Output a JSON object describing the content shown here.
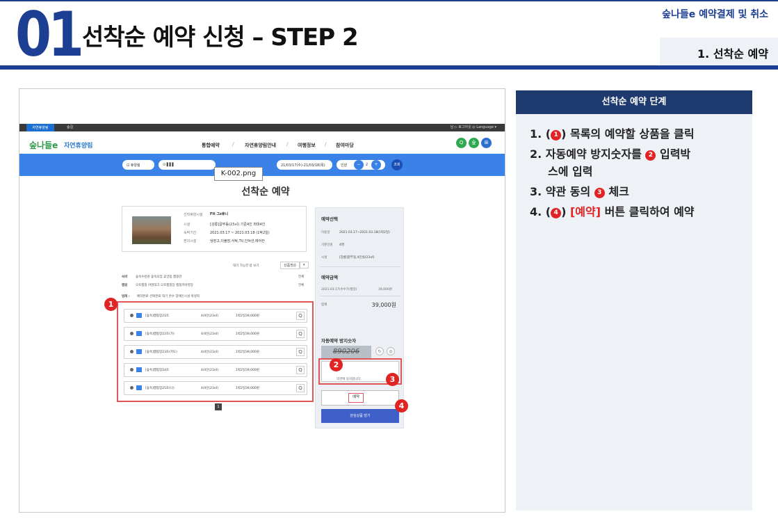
{
  "header": {
    "number": "01",
    "title": "선착순 예약 신청 – STEP 2",
    "subtitle": "숲나들e 예약결제 및 취소",
    "section": "1. 선착순 예약"
  },
  "screenshot": {
    "topbar": {
      "tab1": "자연휴양림",
      "tab2": "숲길",
      "right": "님 ▷ 로그아웃   ◎ Language ▾"
    },
    "logo": "숲나들e",
    "site_name": "자연휴양림",
    "menu": [
      "통합예약",
      "자연휴양림안내",
      "여행정보",
      "참여마당"
    ],
    "menu_sep": "/",
    "nav_icons": [
      "Q",
      "숲",
      "⊞"
    ],
    "search": {
      "field1": "⊡ 휴양림",
      "field2": "⊙ ▌▌▌",
      "dates": "21/03/17(수)-21/03/18(목)",
      "people_label": "인원",
      "people_count": "2",
      "minus": "−",
      "plus": "+",
      "button": "조회"
    },
    "tooltip": "K-002.png",
    "page_title": "선착순 예약",
    "product": {
      "labels": [
        "선착휴양시설",
        "시설",
        "숙박기간",
        "편의시설"
      ],
      "values": [
        "FIt 그z휴니",
        "[강릉]갈뚜동(23㎡) 기준4인 최대4인",
        "2021.03.17 ~ 2021.03.18 (1박2일)",
        "냉장고,이불장,식탁,TV,인덕션,에어컨"
      ]
    },
    "filters": {
      "show_available": "대기 가능한 방 보기",
      "sort": "상품명순",
      "sort_arrow": "▾",
      "row1_label": "숙박",
      "row1": "숲속수련원  숲속의집  휴양림  캠핑관",
      "row1_all": "전체",
      "row2_label": "캠핑",
      "row2": "오토캠핑  야영데크  오토캠핑장  캠핑카야영장",
      "row2_all": "전체",
      "legend_label": "범례 :",
      "legend": "예약완료  선택완료  대기  온수  장애인시설  위생적"
    },
    "rooms": [
      {
        "name": "[숲속]캠핑장21호",
        "size": "4/4인(23㎡)",
        "price": "1박2일39,000원"
      },
      {
        "name": "[숲속]캠핑장22호(가)",
        "size": "4/4인(23㎡)",
        "price": "1박2일39,000원"
      },
      {
        "name": "[숲속]캠핑장23호(지도)",
        "size": "4/4인(23㎡)",
        "price": "1박2일39,000원"
      },
      {
        "name": "[숲속]캠핑장24호",
        "size": "4/4인(23㎡)",
        "price": "1박2일39,000원"
      },
      {
        "name": "[숲속]캠핑장25호(나)",
        "size": "4/4인(23㎡)",
        "price": "1박2일39,000원"
      }
    ],
    "room_magnify": "Q",
    "pagination": "1",
    "side_panel": {
      "select_title": "예약선택",
      "period_label": "이용일",
      "period": "2021.03.17~2021.03.18(1박2일)",
      "people_label": "기준인원",
      "people": "4명",
      "facility_label": "시설",
      "facility": "[강릉]갈뚜동,4인실(23㎡)",
      "amount_title": "예약금액",
      "amount_line_label": "2021.03.17(수수가/평일)",
      "amount_line": "39,000원",
      "total_label": "합계",
      "total": "39,000원",
      "captcha_title": "자동예약 방지숫자",
      "captcha": "890206",
      "refresh": "↻",
      "audio": "◎",
      "agree": "약관에 동의합니다.",
      "reserve": "예약",
      "wishlist": "관심상품 담기"
    },
    "badges": [
      "1",
      "2",
      "3",
      "4"
    ]
  },
  "right_panel": {
    "title": "선착순 예약 단계",
    "steps": [
      {
        "prefix": "1. (",
        "num": "1",
        "suffix": ") 목록의 예약할 상품을 클릭"
      },
      {
        "prefix": "2. 자동예약 방지숫자를 ",
        "num": "2",
        "suffix": " 입력박",
        "cont": "스에 입력"
      },
      {
        "prefix": "3. 약관 동의 ",
        "num": "3",
        "suffix": " 체크"
      },
      {
        "prefix": "4. (",
        "num": "4",
        "suffix_red": " [예약]",
        "suffix_tail": " 버튼 클릭하여 예약",
        "close": ")"
      }
    ]
  },
  "colors": {
    "primary": "#1c3f94",
    "accent_red": "#e02424",
    "panel_bg": "#eef1f6",
    "search_bar": "#3b82e8"
  }
}
